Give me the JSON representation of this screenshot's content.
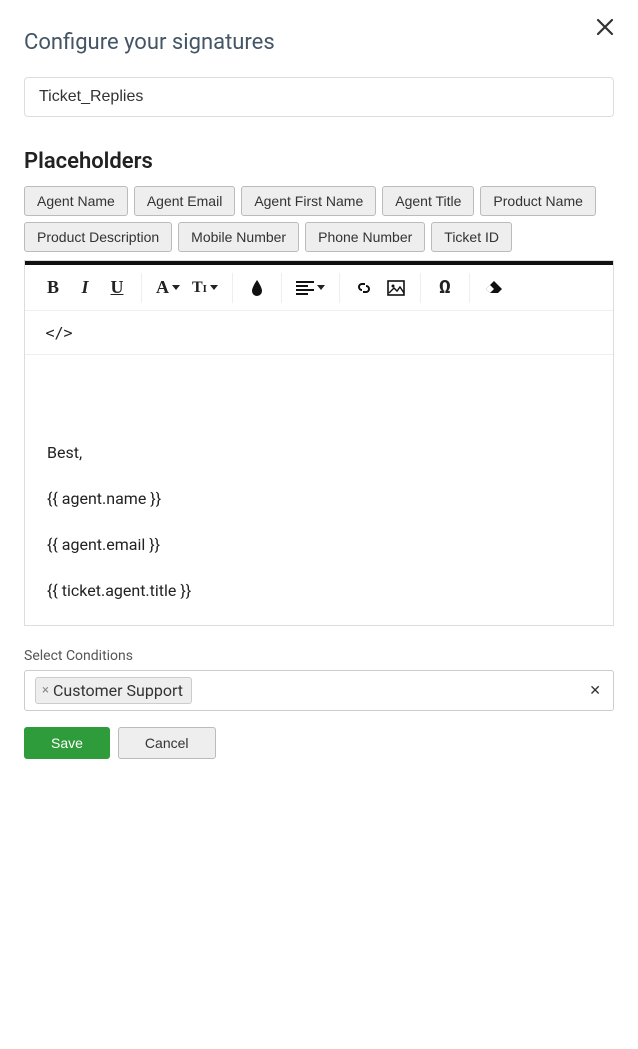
{
  "header": {
    "title": "Configure your signatures"
  },
  "signature_name": "Ticket_Replies",
  "placeholders": {
    "heading": "Placeholders",
    "items": [
      "Agent Name",
      "Agent Email",
      "Agent First Name",
      "Agent Title",
      "Product Name",
      "Product Description",
      "Mobile Number",
      "Phone Number",
      "Ticket ID"
    ]
  },
  "editor": {
    "lines": [
      "Best,",
      "{{ agent.name }}",
      "{{ agent.email }}",
      "{{ ticket.agent.title }}"
    ]
  },
  "conditions": {
    "label": "Select Conditions",
    "tags": [
      "Customer Support"
    ]
  },
  "actions": {
    "save": "Save",
    "cancel": "Cancel"
  }
}
